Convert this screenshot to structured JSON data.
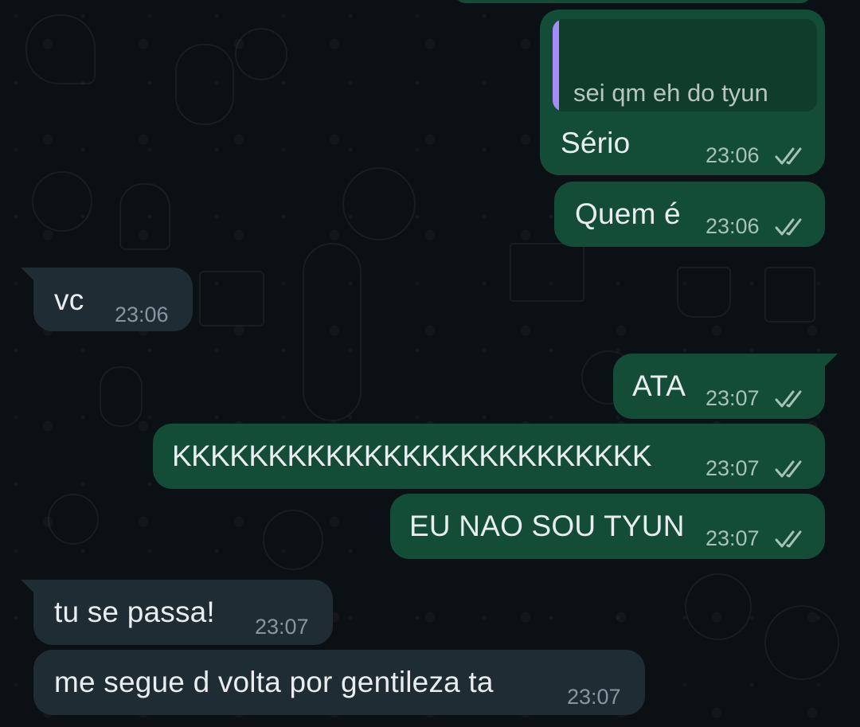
{
  "messages": {
    "m1": {
      "quote": "sei qm eh do tyun",
      "text": "Sério",
      "time": "23:06"
    },
    "m2": {
      "text": "Quem é",
      "time": "23:06"
    },
    "m3": {
      "text": "vc",
      "time": "23:06"
    },
    "m4": {
      "text": "ATA",
      "time": "23:07"
    },
    "m5": {
      "text": "KKKKKKKKKKKKKKKKKKKKKKKKK",
      "time": "23:07"
    },
    "m6": {
      "text": "EU NAO SOU TYUN",
      "time": "23:07"
    },
    "m7": {
      "text": "tu se passa!",
      "time": "23:07"
    },
    "m8": {
      "text": "me segue d volta por gentileza ta",
      "time": "23:07"
    }
  },
  "icons": {
    "read_receipt": "double-check-icon"
  },
  "colors": {
    "background": "#0b1014",
    "outgoing_bubble": "#144d37",
    "incoming_bubble": "#202c33",
    "quote_bar": "#a78bfa"
  }
}
